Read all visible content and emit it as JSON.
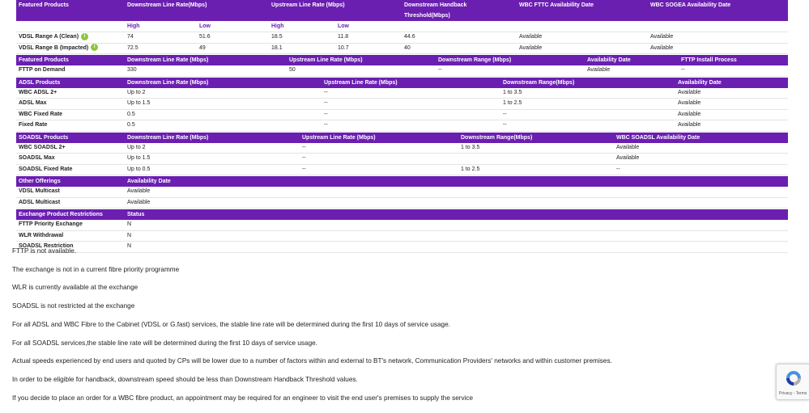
{
  "featured": {
    "headers": [
      "Featured Products",
      "Downstream Line Rate(Mbps)",
      "Upstream Line Rate (Mbps)",
      "Downstream Handback Threshold(Mbps)",
      "WBC FTTC Availability Date",
      "WBC SOGEA Availability Date"
    ],
    "sub": [
      "",
      "High",
      "Low",
      "High",
      "Low",
      "",
      "",
      ""
    ],
    "rows": [
      {
        "name": "VDSL Range A (Clean)",
        "cells": [
          "74",
          "51.6",
          "18.5",
          "11.8",
          "44.6",
          "Available",
          "Available"
        ]
      },
      {
        "name": "VDSL Range B (Impacted)",
        "cells": [
          "72.5",
          "49",
          "18.1",
          "10.7",
          "40",
          "Available",
          "Available"
        ]
      }
    ],
    "info_glyph": "i"
  },
  "fttp": {
    "headers": [
      "Featured Products",
      "Downstream Line Rate (Mbps)",
      "Upstream Line Rate (Mbps)",
      "Downstream Range (Mbps)",
      "Availability Date",
      "FTTP Install Process"
    ],
    "rows": [
      {
        "name": "FTTP on Demand",
        "cells": [
          "330",
          "50",
          "--",
          "Available",
          "--"
        ]
      }
    ]
  },
  "adsl": {
    "headers": [
      "ADSL Products",
      "Downstream Line Rate (Mbps)",
      "Upstream Line Rate (Mbps)",
      "Downstream Range(Mbps)",
      "Availability Date"
    ],
    "rows": [
      {
        "name": "WBC ADSL 2+",
        "cells": [
          "Up to 2",
          "--",
          "1 to 3.5",
          "Available"
        ]
      },
      {
        "name": "ADSL Max",
        "cells": [
          "Up to 1.5",
          "--",
          "1 to 2.5",
          "Available"
        ]
      },
      {
        "name": "WBC Fixed Rate",
        "cells": [
          "0.5",
          "--",
          "--",
          "Available"
        ]
      },
      {
        "name": "Fixed Rate",
        "cells": [
          "0.5",
          "--",
          "--",
          "Available"
        ]
      }
    ]
  },
  "soadsl": {
    "headers": [
      "SOADSL Products",
      "Downstream Line Rate (Mbps)",
      "Upstream Line Rate (Mbps)",
      "Downstream Range(Mbps)",
      "WBC SOADSL Availability Date"
    ],
    "rows": [
      {
        "name": "WBC SOADSL 2+",
        "cells": [
          "Up to 2",
          "--",
          "1 to 3.5",
          "Available"
        ]
      },
      {
        "name": "SOADSL Max",
        "cells": [
          "Up to 1.5",
          "--",
          "",
          "Available"
        ]
      },
      {
        "name": "SOADSL Fixed Rate",
        "cells": [
          "Up to 0.5",
          "--",
          "1 to 2.5",
          "--"
        ]
      }
    ]
  },
  "other": {
    "headers": [
      "Other Offerings",
      "Availability Date"
    ],
    "rows": [
      {
        "name": "VDSL Multicast",
        "cells": [
          "Available"
        ]
      },
      {
        "name": "ADSL Multicast",
        "cells": [
          "Available"
        ]
      }
    ]
  },
  "exchange": {
    "headers": [
      "Exchange Product Restrictions",
      "Status"
    ],
    "rows": [
      {
        "name": "FTTP Priority Exchange",
        "cells": [
          "N"
        ]
      },
      {
        "name": "WLR Withdrawal",
        "cells": [
          "N"
        ]
      },
      {
        "name": "SOADSL Restriction",
        "cells": [
          "N"
        ]
      }
    ]
  },
  "notes": [
    "FTTP is not available.",
    "The exchange is not in a current fibre priority programme",
    "WLR is currently available at the exchange",
    "SOADSL is not restricted at the exchange",
    "For all ADSL and WBC Fibre to the Cabinet (VDSL or G.fast) services, the stable line rate will be determined during the first 10 days of service usage.",
    "For all SOADSL services,the stable line rate will be determined during the first 10 days of service usage.",
    "Actual speeds experienced by end users and quoted by CPs will be lower due to a number of factors within and external to BT's network, Communication Providers' networks and within customer premises.",
    "In order to be eligible for handback, downstream speed should be less than Downstream Handback Threshold values.",
    "If you decide to place an order for a WBC fibre product, an appointment may be required for an engineer to visit the end user's premises to supply the service"
  ],
  "recaptcha": {
    "text": "Privacy - Terms"
  },
  "colors": {
    "header_bg": "#6b1fb1",
    "info_icon": "#8cc63f"
  }
}
